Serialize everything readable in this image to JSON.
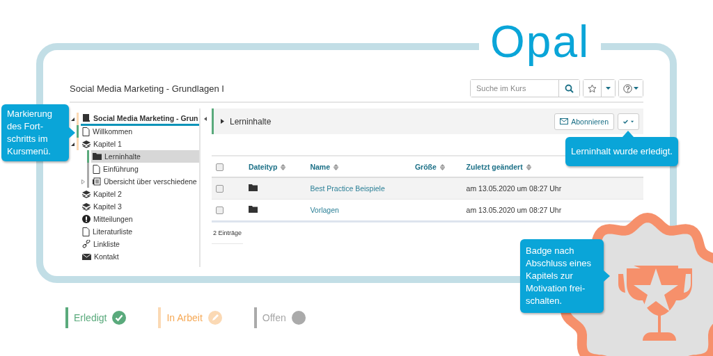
{
  "logo": {
    "text": "Opal"
  },
  "course_title": "Social Media Marketing - Grundlagen I",
  "search": {
    "placeholder": "Suche im Kurs"
  },
  "tree": [
    {
      "kind": "course",
      "label": "Social Media Marketing - Grun",
      "color": "#fbd9b4",
      "expanded": true,
      "selected": false,
      "children": [
        {
          "kind": "page",
          "label": "Willkommen",
          "color": "#5aaa7c",
          "selected": false
        },
        {
          "kind": "chapter",
          "label": "Kapitel 1",
          "color": "#fbd9b4",
          "expanded": true,
          "selected": false,
          "children": [
            {
              "kind": "folder",
              "label": "Lerninhalte",
              "color": "#5aaa7c",
              "selected": true
            },
            {
              "kind": "page",
              "label": "Einführung",
              "color": "#aaaaaa",
              "selected": false
            },
            {
              "kind": "overview",
              "label": "Übersicht über verschiedene",
              "color": "#aaaaaa",
              "expanded": false,
              "selected": false
            }
          ]
        },
        {
          "kind": "chapter",
          "label": "Kapitel 2",
          "selected": false
        },
        {
          "kind": "chapter",
          "label": "Kapitel 3",
          "selected": false
        },
        {
          "kind": "notice",
          "label": "Mitteilungen",
          "selected": false
        },
        {
          "kind": "page",
          "label": "Literaturliste",
          "selected": false
        },
        {
          "kind": "link",
          "label": "Linkliste",
          "selected": false
        },
        {
          "kind": "contact",
          "label": "Kontakt",
          "selected": false
        }
      ]
    }
  ],
  "panel": {
    "title": "Lerninhalte",
    "subscribe_button": "Abonnieren"
  },
  "table": {
    "select_all_checked": false,
    "columns": [
      "Dateityp",
      "Name",
      "Größe",
      "Zuletzt geändert"
    ],
    "rows": [
      {
        "checked": false,
        "name": "Best Practice Beispiele",
        "date": "am 13.05.2020 um 08:27 Uhr"
      },
      {
        "checked": false,
        "name": "Vorlagen",
        "date": "am 13.05.2020 um 08:27 Uhr"
      }
    ],
    "footer": "2 Einträge"
  },
  "callouts": [
    {
      "kind": "menu",
      "text": "Markierung des Fort-schritts im Kursmenü."
    },
    {
      "kind": "status",
      "text": "Lerninhalt wurde erledigt."
    },
    {
      "kind": "badge",
      "text": "Badge nach Abschluss eines Kapitels zur Motivation frei-schalten."
    }
  ],
  "legend": [
    {
      "kind": "done",
      "label": "Erledigt",
      "color": "#5aaa7c"
    },
    {
      "kind": "progress",
      "label": "In Arbeit",
      "color": "#fbd9b4"
    },
    {
      "kind": "open",
      "label": "Offen",
      "color": "#aaaaaa"
    }
  ]
}
